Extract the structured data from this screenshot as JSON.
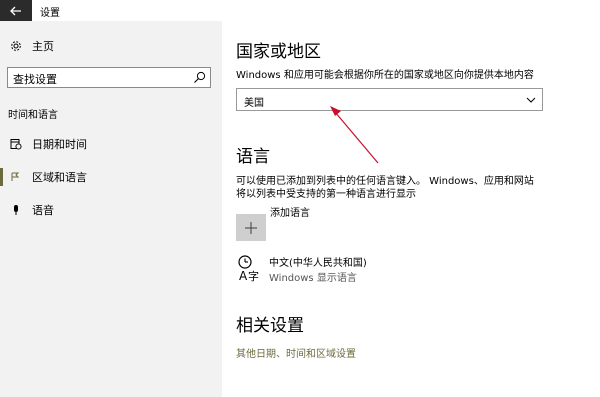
{
  "window": {
    "title": "设置"
  },
  "sidebar": {
    "home_label": "主页",
    "search_placeholder": "查找设置",
    "section_label": "时间和语言",
    "items": [
      {
        "label": "日期和时间",
        "icon": "calendar-clock-icon",
        "active": false
      },
      {
        "label": "区域和语言",
        "icon": "region-language-icon",
        "active": true
      },
      {
        "label": "语音",
        "icon": "microphone-icon",
        "active": false
      }
    ]
  },
  "main": {
    "region_heading": "国家或地区",
    "region_desc": "Windows 和应用可能会根据你所在的国家或地区向你提供本地内容",
    "region_value": "美国",
    "language_heading": "语言",
    "language_desc_line1": "可以使用已添加到列表中的任何语言键入。 Windows、应用和网站",
    "language_desc_line2": "将以列表中受支持的第一种语言进行显示",
    "add_language_label": "添加语言",
    "languages": [
      {
        "name": "中文(中华人民共和国)",
        "sub": "Windows 显示语言"
      }
    ],
    "related_heading": "相关设置",
    "related_link": "其他日期、时间和区域设置"
  },
  "colors": {
    "sidebar_bg": "#f2f2f2",
    "accent": "#6b6b3e",
    "annotation_arrow": "#c8102e"
  }
}
